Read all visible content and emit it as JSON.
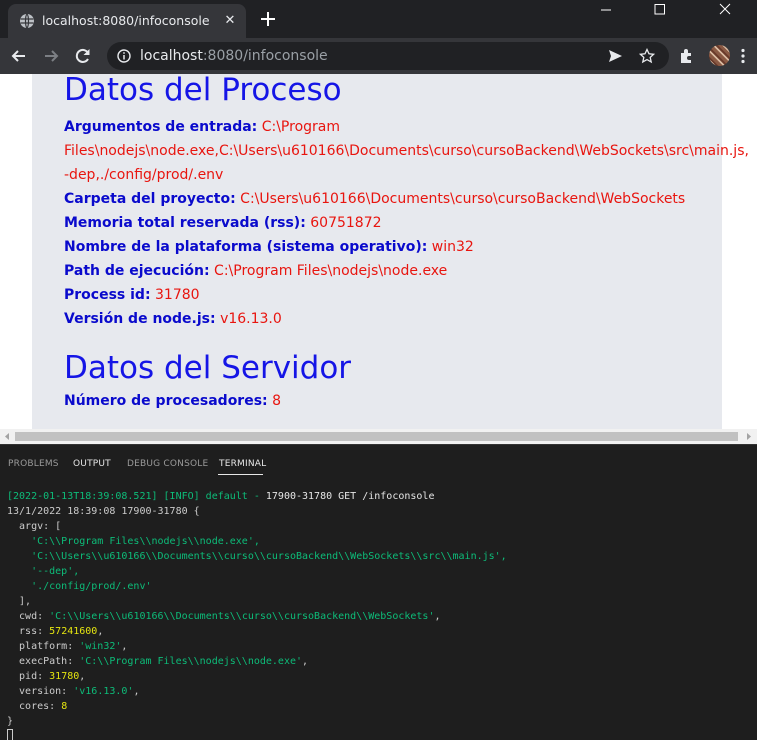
{
  "browser": {
    "tab_title": "localhost:8080/infoconsole",
    "url_host": "localhost",
    "url_rest": ":8080/infoconsole"
  },
  "page": {
    "proceso": {
      "heading": "Datos del Proceso",
      "args_label": "Argumentos de entrada:",
      "args_value_1": "C:\\Program",
      "args_value_2": "Files\\nodejs\\node.exe,C:\\Users\\u610166\\Documents\\curso\\cursoBackend\\WebSockets\\src\\main.js,",
      "args_value_3": "-dep,./config/prod/.env",
      "folder_label": "Carpeta del proyecto:",
      "folder_value": "C:\\Users\\u610166\\Documents\\curso\\cursoBackend\\WebSockets",
      "rss_label": "Memoria total reservada (rss):",
      "rss_value": "60751872",
      "platform_label": "Nombre de la plataforma (sistema operativo):",
      "platform_value": "win32",
      "exec_label": "Path de ejecución:",
      "exec_value": "C:\\Program Files\\nodejs\\node.exe",
      "pid_label": "Process id:",
      "pid_value": "31780",
      "version_label": "Versión de node.js:",
      "version_value": "v16.13.0"
    },
    "servidor": {
      "heading": "Datos del Servidor",
      "cpus_label": "Número de procesadores:",
      "cpus_value": "8"
    }
  },
  "panel": {
    "tabs": [
      "PROBLEMS",
      "OUTPUT",
      "DEBUG CONSOLE",
      "TERMINAL"
    ],
    "active_tab": "TERMINAL"
  },
  "terminal": {
    "log_line_prefix": "[2022-01-13T18:39:08.521] [INFO] default - ",
    "log_line_rest": "17900-31780 GET /infoconsole",
    "line2": "13/1/2022 18:39:08 17900-31780 {",
    "argv_open": "  argv: [",
    "argv_1": "    'C:\\\\Program Files\\\\nodejs\\\\node.exe',",
    "argv_2": "    'C:\\\\Users\\\\u610166\\\\Documents\\\\curso\\\\cursoBackend\\\\WebSockets\\\\src\\\\main.js',",
    "argv_3": "    '--dep',",
    "argv_4": "    './config/prod/.env'",
    "argv_close": "  ],",
    "cwd_key": "  cwd: ",
    "cwd_val": "'C:\\\\Users\\\\u610166\\\\Documents\\\\curso\\\\cursoBackend\\\\WebSockets'",
    "rss_key": "  rss: ",
    "rss_val": "57241600",
    "platform_key": "  platform: ",
    "platform_val": "'win32'",
    "exec_key": "  execPath: ",
    "exec_val": "'C:\\\\Program Files\\\\nodejs\\\\node.exe'",
    "pid_key": "  pid: ",
    "pid_val": "31780",
    "version_key": "  version: ",
    "version_val": "'v16.13.0'",
    "cores_key": "  cores: ",
    "cores_val": "8",
    "close": "}",
    "comma": ","
  },
  "colors": {
    "heading": "#1515e6",
    "label": "#0a0acc",
    "value": "#e8150f",
    "term_string": "#0dbc79",
    "term_number": "#e5e510"
  }
}
